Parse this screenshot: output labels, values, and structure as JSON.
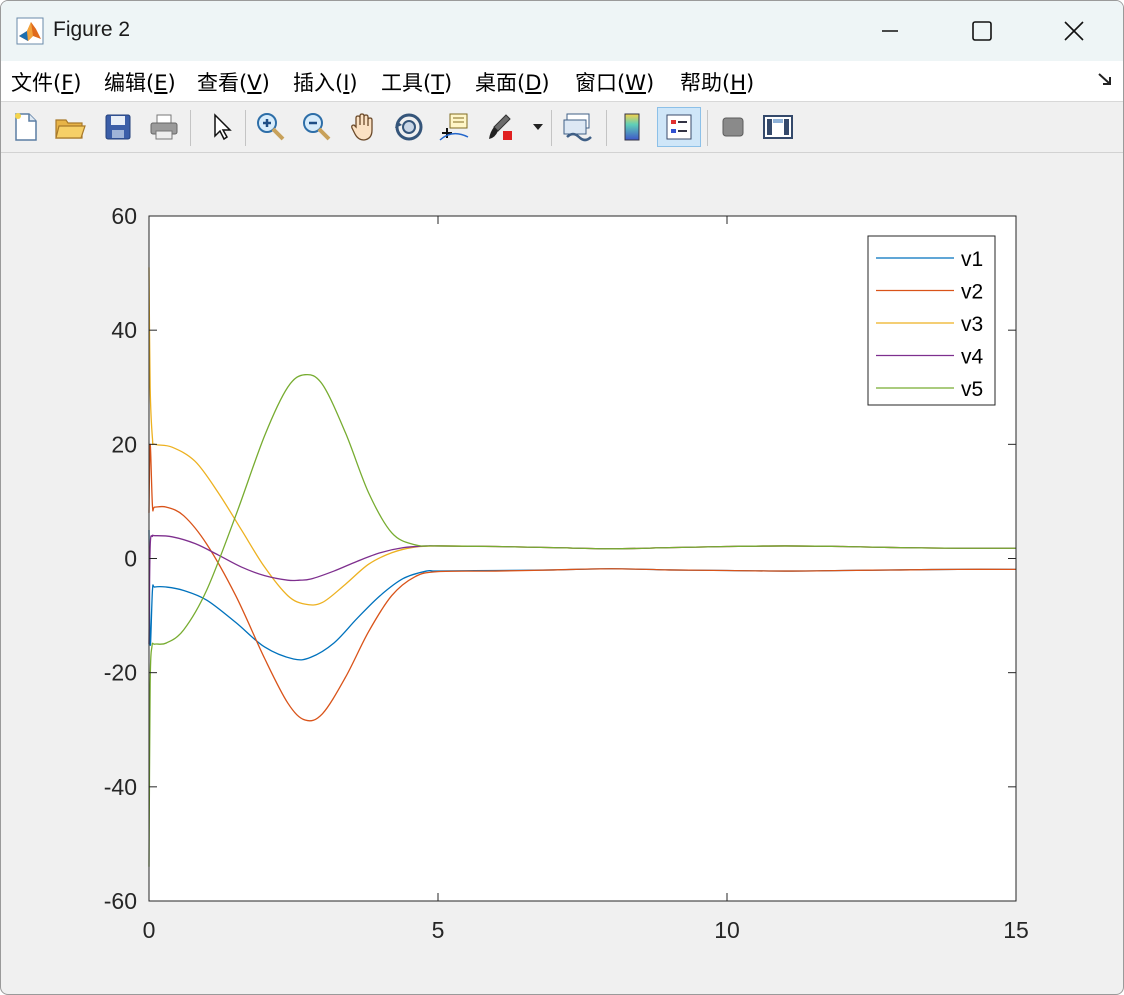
{
  "window": {
    "title": "Figure 2",
    "controls": {
      "minimize": "—",
      "maximize": "☐",
      "close": "✕"
    }
  },
  "menu": {
    "items": [
      {
        "pre": "文件(",
        "key": "F",
        "post": ")"
      },
      {
        "pre": "编辑(",
        "key": "E",
        "post": ")"
      },
      {
        "pre": "查看(",
        "key": "V",
        "post": ")"
      },
      {
        "pre": "插入(",
        "key": "I",
        "post": ")"
      },
      {
        "pre": "工具(",
        "key": "T",
        "post": ")"
      },
      {
        "pre": "桌面(",
        "key": "D",
        "post": ")"
      },
      {
        "pre": "窗口(",
        "key": "W",
        "post": ")"
      },
      {
        "pre": "帮助(",
        "key": "H",
        "post": ")"
      }
    ],
    "undock_icon": "undock-arrow-icon"
  },
  "toolbar": {
    "buttons": [
      "new-figure",
      "open-file",
      "save",
      "print",
      "edit-plot-arrow",
      "zoom-in",
      "zoom-out",
      "pan-hand",
      "rotate-3d",
      "data-cursor",
      "brush",
      "link-plot",
      "insert-colorbar",
      "insert-legend",
      "hide-plot-tools",
      "show-plot-tools"
    ],
    "active": "insert-legend"
  },
  "chart_data": {
    "type": "line",
    "title": "",
    "xlabel": "",
    "ylabel": "",
    "xlim": [
      0,
      15
    ],
    "ylim": [
      -60,
      60
    ],
    "xticks": [
      0,
      5,
      10,
      15
    ],
    "yticks": [
      -60,
      -40,
      -20,
      0,
      20,
      40,
      60
    ],
    "grid": false,
    "legend_position": "top-right",
    "series": [
      {
        "name": "v1",
        "color": "#0072bd",
        "x": [
          0,
          0.02,
          0.06,
          0.1,
          0.3,
          0.6,
          1.0,
          1.5,
          2.0,
          2.5,
          2.8,
          3.2,
          3.6,
          4.0,
          4.4,
          4.8,
          5.0,
          6,
          7,
          8,
          9,
          10,
          11,
          12,
          13,
          14,
          15
        ],
        "y": [
          5,
          -15,
          -5.5,
          -5,
          -5,
          -5.6,
          -7.3,
          -11.2,
          -15.5,
          -17.6,
          -17.3,
          -14.8,
          -10.5,
          -6.5,
          -3.5,
          -2.2,
          -2.2,
          -2.1,
          -2.0,
          -1.8,
          -2.0,
          -2.1,
          -2.2,
          -2.1,
          -2.0,
          -1.9,
          -1.9
        ]
      },
      {
        "name": "v2",
        "color": "#d95319",
        "x": [
          0,
          0.02,
          0.06,
          0.1,
          0.3,
          0.6,
          1.0,
          1.5,
          2.0,
          2.4,
          2.7,
          3.0,
          3.4,
          3.8,
          4.2,
          4.6,
          5.0,
          6,
          7,
          8,
          9,
          10,
          11,
          12,
          13,
          14,
          15
        ],
        "y": [
          8,
          20,
          9.2,
          9,
          9,
          7.5,
          2.5,
          -6.5,
          -17.5,
          -25.3,
          -28.3,
          -27.2,
          -20.8,
          -12.8,
          -6.5,
          -3.2,
          -2.3,
          -2.2,
          -2.0,
          -1.8,
          -2.0,
          -2.1,
          -2.2,
          -2.1,
          -2.0,
          -1.9,
          -1.9
        ]
      },
      {
        "name": "v3",
        "color": "#edb120",
        "x": [
          0,
          0.02,
          0.06,
          0.1,
          0.4,
          0.8,
          1.2,
          1.6,
          2.0,
          2.4,
          2.7,
          3.0,
          3.4,
          3.8,
          4.2,
          4.6,
          5.0,
          6,
          7,
          8,
          9,
          10,
          11,
          12,
          13,
          14,
          15
        ],
        "y": [
          51,
          30,
          21,
          20,
          19.5,
          17,
          11.5,
          5,
          -1.5,
          -6.5,
          -8,
          -7.7,
          -4.5,
          -1,
          1,
          2,
          2.2,
          2.1,
          1.9,
          1.7,
          1.9,
          2.1,
          2.2,
          2.1,
          1.9,
          1.8,
          1.8
        ]
      },
      {
        "name": "v4",
        "color": "#7e2f8e",
        "x": [
          0,
          0.02,
          0.06,
          0.1,
          0.4,
          0.8,
          1.2,
          1.6,
          2.0,
          2.4,
          2.6,
          2.8,
          3.2,
          3.6,
          4.0,
          4.4,
          4.8,
          5.0,
          6,
          7,
          8,
          9,
          10,
          11,
          12,
          13,
          14,
          15
        ],
        "y": [
          -15,
          2,
          3.9,
          4,
          3.8,
          2.6,
          0.6,
          -1.5,
          -3,
          -3.8,
          -3.8,
          -3.6,
          -2.2,
          -0.5,
          1.0,
          1.9,
          2.2,
          2.2,
          2.1,
          1.9,
          1.7,
          1.9,
          2.1,
          2.2,
          2.1,
          1.9,
          1.8,
          1.8
        ]
      },
      {
        "name": "v5",
        "color": "#77ac30",
        "x": [
          0,
          0.02,
          0.05,
          0.1,
          0.3,
          0.6,
          1.0,
          1.5,
          2.0,
          2.4,
          2.7,
          3.0,
          3.4,
          3.8,
          4.2,
          4.6,
          5.0,
          6,
          7,
          8,
          9,
          10,
          11,
          12,
          13,
          14,
          15
        ],
        "y": [
          -54,
          -22,
          -15.5,
          -15,
          -14.8,
          -12.5,
          -5.5,
          7.5,
          21.5,
          30,
          32.2,
          30.5,
          22,
          11.5,
          4.5,
          2.4,
          2.2,
          2.1,
          1.9,
          1.7,
          1.9,
          2.1,
          2.2,
          2.1,
          1.9,
          1.8,
          1.8
        ]
      }
    ]
  }
}
